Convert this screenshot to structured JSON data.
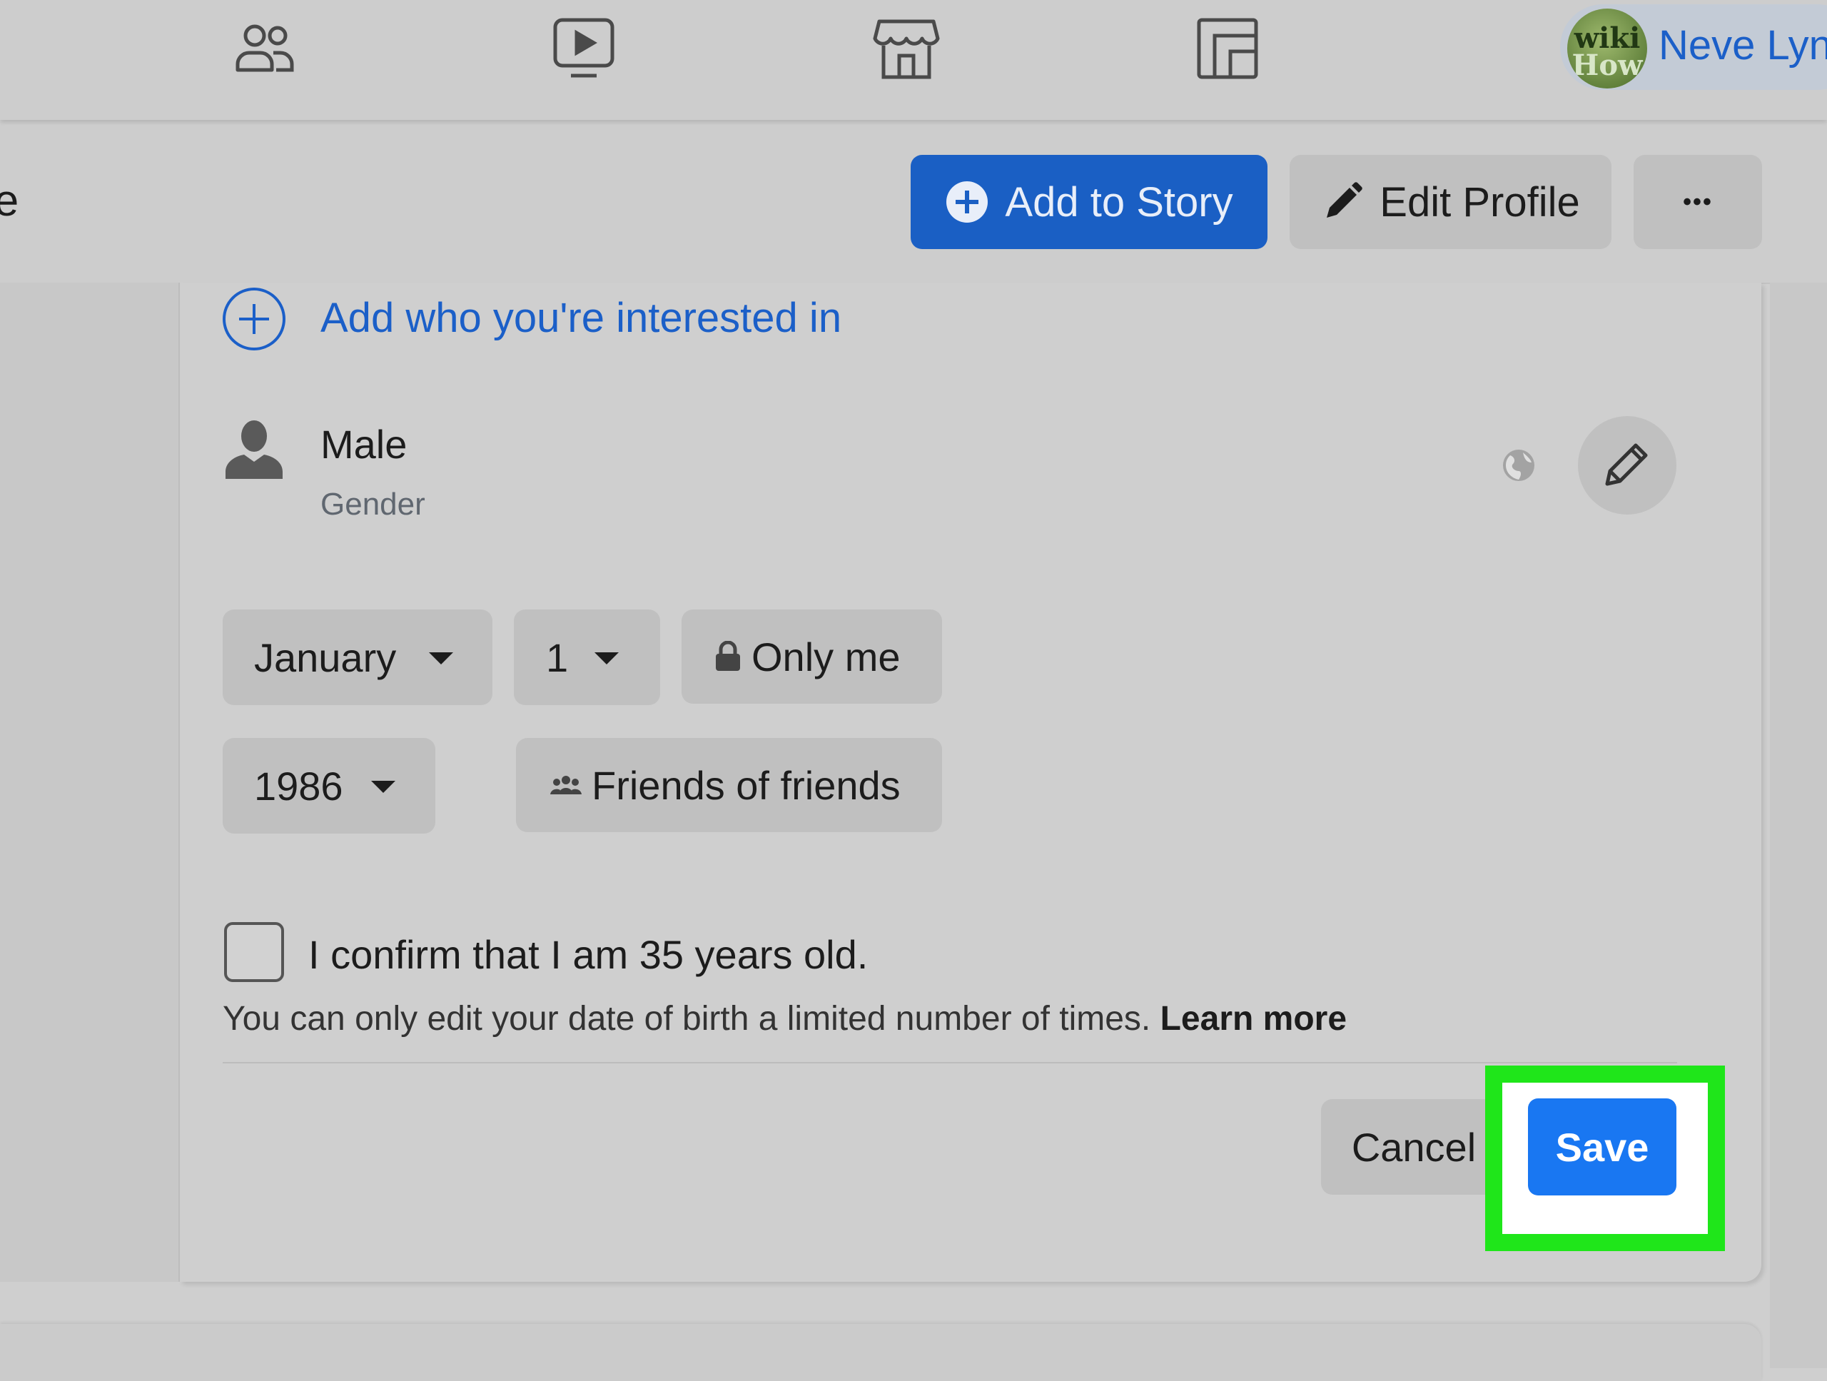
{
  "account": {
    "name": "Neve Lyn",
    "avatar_logo_top": "wiki",
    "avatar_logo_bottom": "How"
  },
  "nav": {
    "icons": [
      "friends-icon",
      "watch-icon",
      "marketplace-icon",
      "groups-icon"
    ]
  },
  "profile_header": {
    "title_fragment": "le",
    "add_story_label": "Add to Story",
    "edit_profile_label": "Edit Profile",
    "more_label": "•••"
  },
  "interested_in": {
    "add_label": "Add who you're interested in"
  },
  "gender": {
    "value": "Male",
    "label": "Gender"
  },
  "birthday": {
    "month": "January",
    "day": "1",
    "year": "1986",
    "date_privacy": "Only me",
    "year_privacy": "Friends of friends"
  },
  "confirm": {
    "label": "I confirm that I am 35 years old.",
    "note": "You can only edit your date of birth a limited number of times.",
    "learn_more": "Learn more"
  },
  "actions": {
    "cancel_label": "Cancel",
    "save_label": "Save"
  },
  "colors": {
    "primary_blue": "#1977f2",
    "link_blue": "#1b5fc8",
    "highlight": "#1fe61a"
  }
}
